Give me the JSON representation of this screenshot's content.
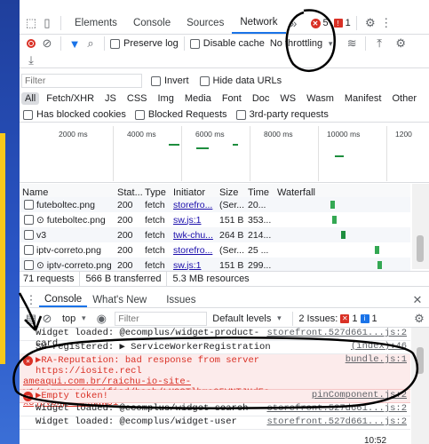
{
  "toolbar": {
    "tabs": [
      "Elements",
      "Console",
      "Sources",
      "Network"
    ],
    "active_tab": "Network",
    "more_tabs": "»",
    "errors_count": "5",
    "warnings_count": "1"
  },
  "network_toolbar": {
    "preserve_log": "Preserve log",
    "disable_cache": "Disable cache",
    "throttling": "No throttling"
  },
  "filter": {
    "placeholder": "Filter",
    "invert": "Invert",
    "hide_data_urls": "Hide data URLs",
    "types": [
      "All",
      "Fetch/XHR",
      "JS",
      "CSS",
      "Img",
      "Media",
      "Font",
      "Doc",
      "WS",
      "Wasm",
      "Manifest",
      "Other"
    ],
    "has_blocked_cookies": "Has blocked cookies",
    "blocked_requests": "Blocked Requests",
    "third_party": "3rd-party requests"
  },
  "timeline": {
    "ticks": [
      "2000 ms",
      "4000 ms",
      "6000 ms",
      "8000 ms",
      "10000 ms",
      "1200"
    ]
  },
  "table": {
    "headers": [
      "Name",
      "Stat...",
      "Type",
      "Initiator",
      "Size",
      "Time",
      "Waterfall"
    ],
    "rows": [
      {
        "name": "futeboltec.png",
        "status": "200",
        "type": "fetch",
        "initiator": "storefro...",
        "size": "(Ser...",
        "time": "20..."
      },
      {
        "name": "⊙ futeboltec.png",
        "status": "200",
        "type": "fetch",
        "initiator": "sw.js:1",
        "size": "151 B",
        "time": "353..."
      },
      {
        "name": "v3",
        "status": "200",
        "type": "fetch",
        "initiator": "twk-chu...",
        "size": "264 B",
        "time": "214..."
      },
      {
        "name": "iptv-correto.png",
        "status": "200",
        "type": "fetch",
        "initiator": "storefro...",
        "size": "(Ser...",
        "time": "25 ..."
      },
      {
        "name": "⊙ iptv-correto.png",
        "status": "200",
        "type": "fetch",
        "initiator": "sw.js:1",
        "size": "151 B",
        "time": "299..."
      }
    ]
  },
  "summary": {
    "requests": "71 requests",
    "transferred": "566 B transferred",
    "resources": "5.3 MB resources"
  },
  "drawer": {
    "tabs": [
      "Console",
      "What's New",
      "Issues"
    ],
    "context": "top",
    "filter_placeholder": "Filter",
    "levels": "Default levels",
    "issues_label": "2 Issues:",
    "issues_err": "1",
    "issues_info": "1"
  },
  "console": {
    "lines": [
      {
        "kind": "log",
        "text": "Widget loaded: @ecomplus/widget-product-card",
        "src": "storefront.527d661...js:2"
      },
      {
        "kind": "log",
        "text": "SW registered: ▶ ServiceWorkerRegistration",
        "src": "(index):46"
      },
      {
        "kind": "err",
        "text": "▶RA-Reputation: bad response from server https://iosite.recl",
        "src": "bundle.js:1",
        "cont1": "ameaqui.com.br/raichu-io-site-v1/company/verified/hash/LU93Tlhma05VNTJHdEs",
        "cont2": "xUjpvbnp1LW9uaW51"
      },
      {
        "kind": "err",
        "text": "▶Empty token!",
        "src": "pinComponent.js:2"
      },
      {
        "kind": "log",
        "text": "Widget loaded: @ecomplus/widget-search",
        "src": "storefront.527d661...js:2"
      },
      {
        "kind": "log",
        "text": "Widget loaded: @ecomplus/widget-user",
        "src": "storefront.527d661...js:2"
      }
    ]
  },
  "clock": "10:52",
  "colors": {
    "accent": "#1a73e8",
    "error": "#d93025"
  }
}
